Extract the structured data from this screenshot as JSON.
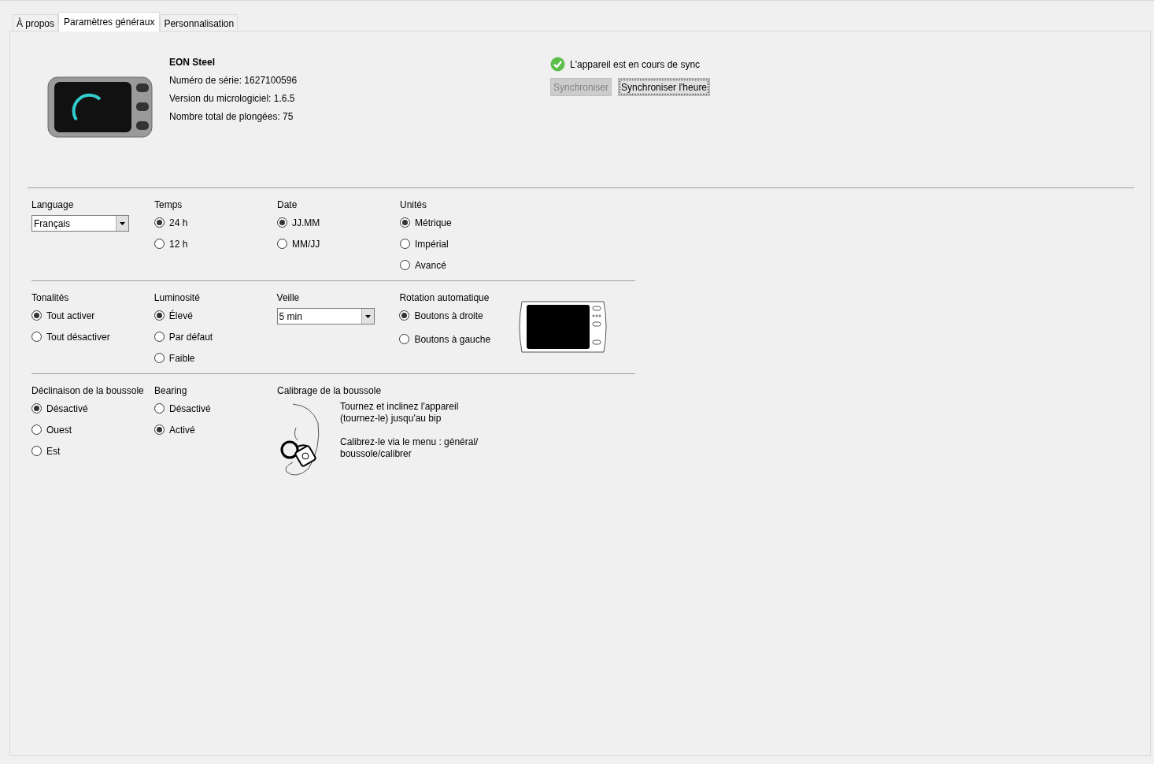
{
  "tabs": [
    {
      "label": "À propos",
      "selected": false
    },
    {
      "label": "Paramètres généraux",
      "selected": true
    },
    {
      "label": "Personnalisation",
      "selected": false
    }
  ],
  "device": {
    "name": "EON Steel",
    "details": [
      "Numéro de série: 1627100596",
      "Version du micrologiciel: 1.6.5",
      "Nombre total de plongées: 75"
    ]
  },
  "sync": {
    "status": "L'appareil est en cours de sync",
    "buttons": [
      {
        "label": "Synchroniser",
        "disabled": true,
        "focused": false
      },
      {
        "label": "Synchroniser l'heure",
        "disabled": false,
        "focused": true
      }
    ]
  },
  "rows": [
    [
      {
        "kind": "dropdown",
        "label": "Language",
        "value": "Français"
      },
      {
        "kind": "radio",
        "label": "Temps",
        "options": [
          {
            "label": "24 h",
            "selected": true
          },
          {
            "label": "12 h",
            "selected": false
          }
        ]
      },
      {
        "kind": "radio",
        "label": "Date",
        "options": [
          {
            "label": "JJ.MM",
            "selected": true
          },
          {
            "label": "MM/JJ",
            "selected": false
          }
        ]
      },
      {
        "kind": "radio",
        "label": "Unités",
        "options": [
          {
            "label": "Métrique",
            "selected": true
          },
          {
            "label": "Impérial",
            "selected": false
          },
          {
            "label": "Avancé",
            "selected": false
          }
        ]
      }
    ],
    [
      {
        "kind": "radio",
        "label": "Tonalités",
        "options": [
          {
            "label": "Tout activer",
            "selected": true
          },
          {
            "label": "Tout désactiver",
            "selected": false
          }
        ]
      },
      {
        "kind": "radio",
        "label": "Luminosité",
        "options": [
          {
            "label": "Élevé",
            "selected": true
          },
          {
            "label": "Par défaut",
            "selected": false
          },
          {
            "label": "Faible",
            "selected": false
          }
        ]
      },
      {
        "kind": "dropdown",
        "label": "Veille",
        "value": "5 min"
      },
      {
        "kind": "rotation",
        "label": "Rotation automatique",
        "options": [
          {
            "label": "Boutons à droite",
            "selected": true
          },
          {
            "label": "Boutons à gauche",
            "selected": false
          }
        ]
      }
    ],
    [
      {
        "kind": "radio",
        "label": "Déclinaison de la boussole",
        "options": [
          {
            "label": "Désactivé",
            "selected": true
          },
          {
            "label": "Ouest",
            "selected": false
          },
          {
            "label": "Est",
            "selected": false
          }
        ]
      },
      {
        "kind": "radio",
        "label": "Bearing",
        "options": [
          {
            "label": "Désactivé",
            "selected": false
          },
          {
            "label": "Activé",
            "selected": true
          }
        ]
      },
      {
        "kind": "calibration",
        "label": "Calibrage de la boussole",
        "paragraphs": [
          "Tournez et inclinez l'appareil (tournez-le) jusqu'au bip",
          "Calibrez-le via le menu : général/ boussole/calibrer"
        ]
      }
    ]
  ]
}
